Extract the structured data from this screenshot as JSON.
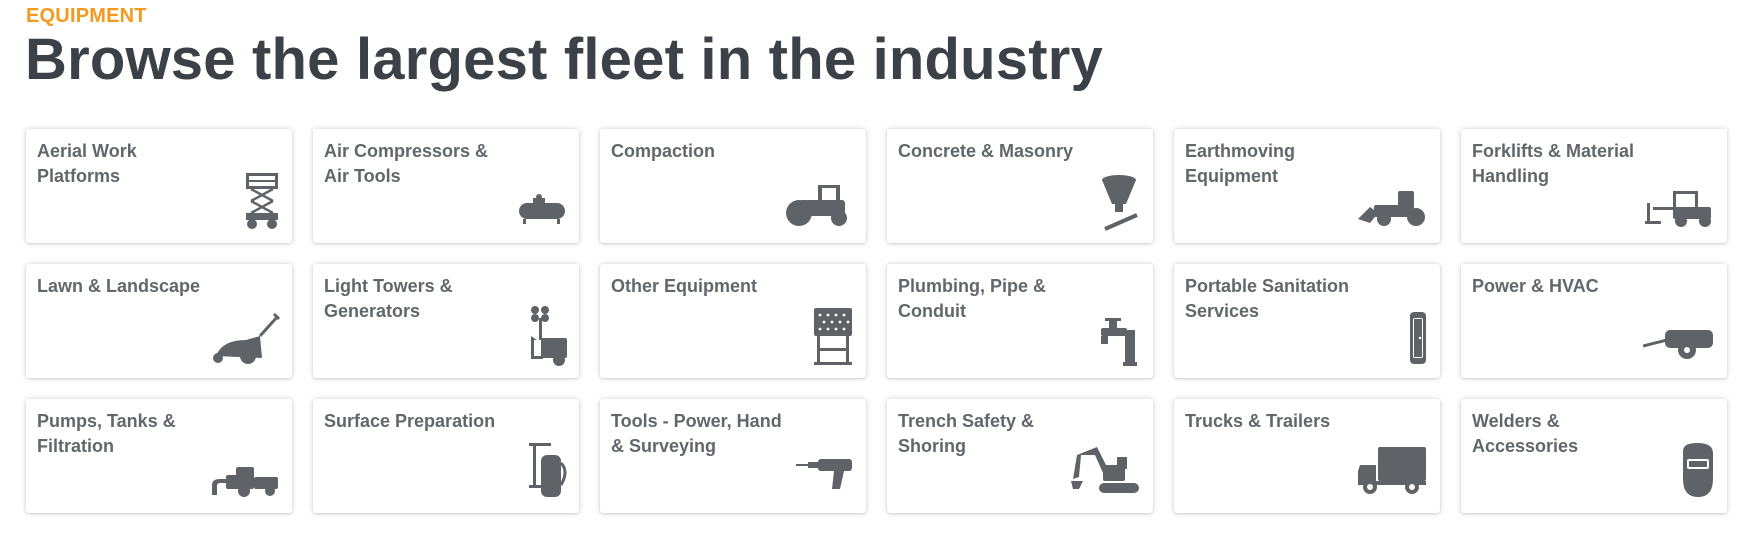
{
  "section": {
    "eyebrow": "EQUIPMENT",
    "title": "Browse the largest fleet in the industry"
  },
  "accent_color": "#f39a1f",
  "icon_color": "#5f6368",
  "categories": [
    {
      "label": "Aerial Work Platforms",
      "icon": "scissor-lift-icon"
    },
    {
      "label": "Air Compressors & Air Tools",
      "icon": "air-compressor-icon"
    },
    {
      "label": "Compaction",
      "icon": "road-roller-icon"
    },
    {
      "label": "Concrete & Masonry",
      "icon": "concrete-hopper-icon"
    },
    {
      "label": "Earthmoving Equipment",
      "icon": "wheel-loader-icon"
    },
    {
      "label": "Forklifts & Material Handling",
      "icon": "forklift-icon"
    },
    {
      "label": "Lawn & Landscape",
      "icon": "lawn-mower-icon"
    },
    {
      "label": "Light Towers & Generators",
      "icon": "light-tower-icon"
    },
    {
      "label": "Other Equipment",
      "icon": "message-board-icon"
    },
    {
      "label": "Plumbing, Pipe & Conduit",
      "icon": "faucet-pipe-icon"
    },
    {
      "label": "Portable Sanitation Services",
      "icon": "portable-toilet-icon"
    },
    {
      "label": "Power & HVAC",
      "icon": "towable-generator-icon"
    },
    {
      "label": "Pumps, Tanks & Filtration",
      "icon": "pump-icon"
    },
    {
      "label": "Surface Preparation",
      "icon": "floor-buffer-icon"
    },
    {
      "label": "Tools - Power, Hand & Surveying",
      "icon": "drill-icon"
    },
    {
      "label": "Trench Safety & Shoring",
      "icon": "excavator-icon"
    },
    {
      "label": "Trucks & Trailers",
      "icon": "box-truck-icon"
    },
    {
      "label": "Welders & Accessories",
      "icon": "welding-helmet-icon"
    }
  ]
}
